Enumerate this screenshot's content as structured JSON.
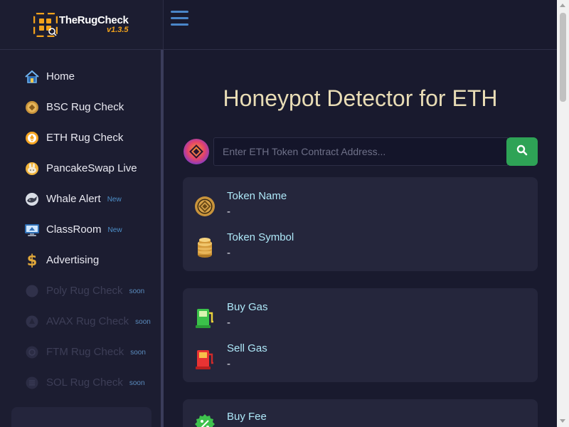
{
  "brand": {
    "name": "TheRugCheck",
    "version": "v1.3.5"
  },
  "colors": {
    "accent_green": "#2ea356",
    "title_gold": "#e8dcb5",
    "label_cyan": "#aee8f8",
    "badge_blue": "#4c8fc9"
  },
  "sidebar": {
    "items": [
      {
        "label": "Home",
        "icon": "home-icon",
        "badge": "",
        "disabled": false
      },
      {
        "label": "BSC Rug Check",
        "icon": "bnb-coin-icon",
        "badge": "",
        "disabled": false
      },
      {
        "label": "ETH Rug Check",
        "icon": "eth-coin-icon",
        "badge": "",
        "disabled": false
      },
      {
        "label": "PancakeSwap Live",
        "icon": "pancake-bunny-icon",
        "badge": "",
        "disabled": false
      },
      {
        "label": "Whale Alert",
        "icon": "whale-icon",
        "badge": "New",
        "disabled": false
      },
      {
        "label": "ClassRoom",
        "icon": "monitor-icon",
        "badge": "New",
        "disabled": false
      },
      {
        "label": "Advertising",
        "icon": "dollar-icon",
        "badge": "",
        "disabled": false
      },
      {
        "label": "Poly Rug Check",
        "icon": "polygon-icon",
        "badge": "soon",
        "disabled": true
      },
      {
        "label": "AVAX Rug Check",
        "icon": "avax-icon",
        "badge": "soon",
        "disabled": true
      },
      {
        "label": "FTM Rug Check",
        "icon": "fantom-icon",
        "badge": "soon",
        "disabled": true
      },
      {
        "label": "SOL Rug Check",
        "icon": "solana-icon",
        "badge": "soon",
        "disabled": true
      }
    ]
  },
  "main": {
    "title": "Honeypot Detector for ETH",
    "search": {
      "placeholder": "Enter ETH Token Contract Address...",
      "value": ""
    },
    "token_card": {
      "name_label": "Token Name",
      "name_value": "-",
      "symbol_label": "Token Symbol",
      "symbol_value": "-"
    },
    "gas_card": {
      "buy_label": "Buy Gas",
      "buy_value": "-",
      "sell_label": "Sell Gas",
      "sell_value": "-"
    },
    "fee_card": {
      "buy_label": "Buy Fee"
    }
  }
}
